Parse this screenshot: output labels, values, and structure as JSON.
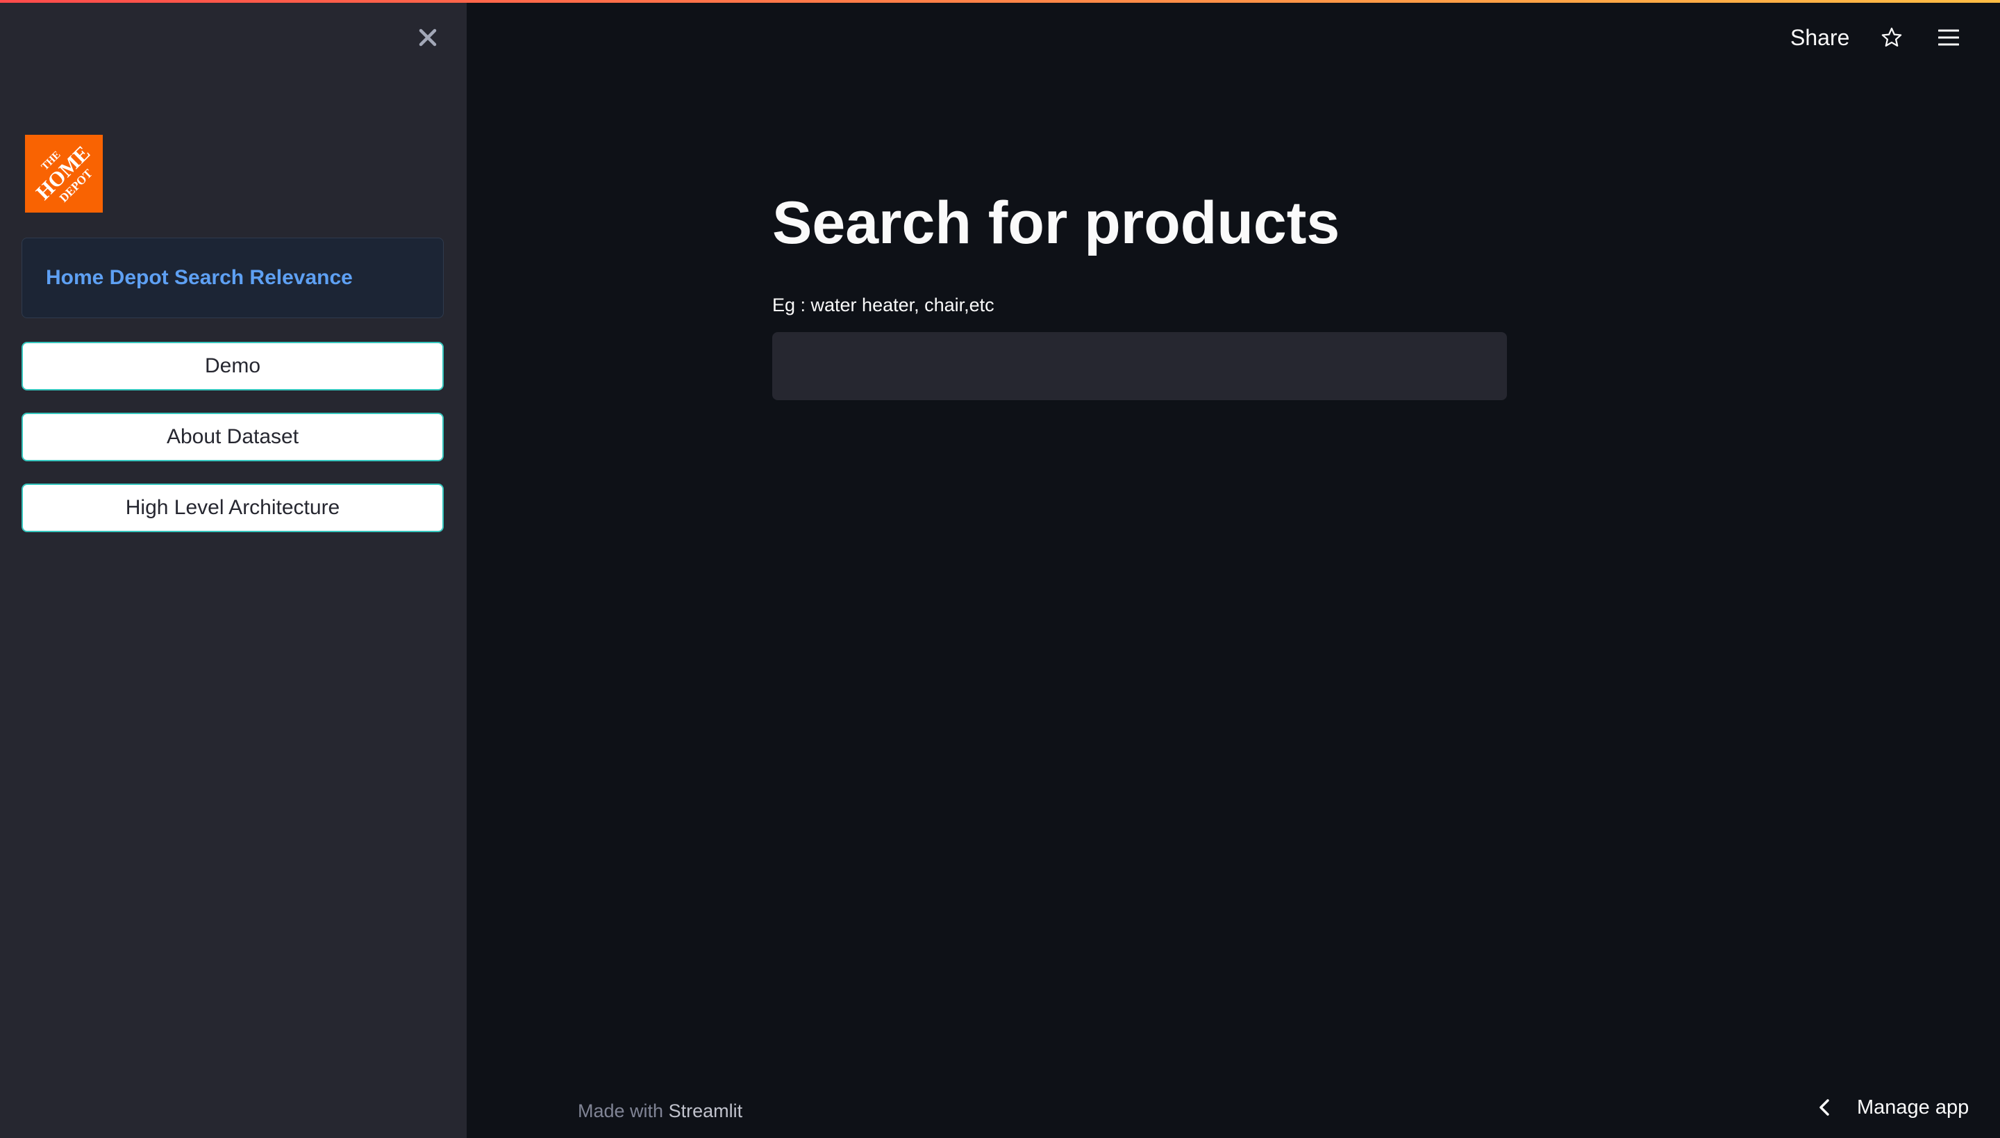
{
  "sidebar": {
    "logo_name": "home-depot-logo",
    "logo_text": [
      "THE",
      "HOME",
      "DEPOT"
    ],
    "info_title": "Home Depot Search Relevance",
    "nav_buttons": [
      {
        "label": "Demo"
      },
      {
        "label": "About Dataset"
      },
      {
        "label": "High Level Architecture"
      }
    ]
  },
  "header": {
    "share_label": "Share"
  },
  "main": {
    "title": "Search for products",
    "input_label": "Eg : water heater, chair,etc",
    "input_value": ""
  },
  "footer": {
    "made_with": "Made with",
    "brand": "Streamlit",
    "manage_app": "Manage app"
  },
  "colors": {
    "app_background": "#0e1117",
    "sidebar_background": "#262730",
    "accent_blue": "#5ea0f3",
    "button_border": "#36c6be",
    "logo_orange": "#f96302"
  }
}
